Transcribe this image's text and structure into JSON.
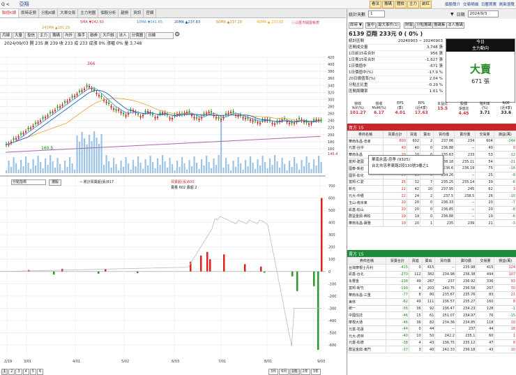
{
  "window": {
    "title": "亞翔",
    "nav_back": "Q <",
    "right_buttons": [
      "看法",
      "籌碼",
      "體檢",
      "主力",
      "啟紅"
    ],
    "links": [
      "個股簡介",
      "交易明細",
      "日曆買賣",
      "刷新瀏覽"
    ]
  },
  "tabs": [
    "聯經K線",
    "即時走勢",
    "分點K線",
    "大單交易",
    "主力地圖",
    "個股分析",
    "趨勢",
    "資訊",
    "官網"
  ],
  "ma": [
    {
      "t": "5MA ▼242.50",
      "c": "#c33"
    },
    {
      "t": "10MA ▼241.65",
      "c": "#3a8ad8"
    },
    {
      "t": "20MA ▲237.83",
      "c": "#0d4fae"
    },
    {
      "t": "60MA ▲237.28",
      "c": "#c48a1a"
    },
    {
      "t": "40MA ▲ 233.65",
      "c": "#f0a020"
    },
    {
      "t": "240MA ▲181.29",
      "c": "#c93"
    },
    {
      "t": "ⓘ以匯市開盤帳表",
      "c": "#c37"
    }
  ],
  "subtabs": [
    "月線",
    "大量",
    "投信",
    "主力",
    "籌碼",
    "內外",
    "換手",
    "融券",
    "大戶融",
    "法人",
    "分價圖",
    "日線"
  ],
  "info_line": "2024/09/03 開 235 高 239 收 233 成 233  成漲 0% 漲幅 0% 量 3,748",
  "chart_data": {
    "type": "line",
    "dates": [
      "2/19",
      "3/01",
      "4/01",
      "5/02",
      "6/03",
      "7/01",
      "8/01",
      "9/03"
    ],
    "price_ticks": [
      420,
      400,
      380,
      360,
      340,
      320,
      300,
      280,
      260,
      240,
      220,
      200,
      180,
      160,
      146.4
    ],
    "price_high": 366,
    "price_low": 160.5,
    "last": 146.4,
    "indicator_ticks": [
      700,
      600,
      500,
      400,
      300,
      200,
      100,
      0,
      -100,
      -200,
      -300,
      -400,
      -500,
      -600
    ]
  },
  "lower": {
    "dropdown": "分點指標",
    "btn": "選股",
    "legend1": "─ 累計買賣超(張)817",
    "legend2": "買賣超(張)600",
    "legend3": "賣量 602 賣超 2"
  },
  "bottom_tabs": [
    "1",
    "2",
    "3",
    "4",
    "5",
    "6"
  ],
  "range_tabs": [
    "3月",
    "6月",
    "1年",
    "2年",
    "3年"
  ],
  "date_footer": "2024/09/03",
  "right": {
    "label_range": "統計天數",
    "days": "1",
    "sel": "▼",
    "date_label": "日期",
    "date": "2024/9/3",
    "tag1": "即時 ▼",
    "tags": [
      "盤中",
      "最大事件(1)",
      "財報",
      "分點籌碼",
      "籌碼集",
      "法人籌碼"
    ],
    "stock_title": "6139 亞翔  233元  0 ( 0% )",
    "kv": [
      [
        "統計區間",
        "20240903 ~ 20240903"
      ],
      [
        "區間成交量",
        "3,748 張"
      ],
      [
        "1日前15名合計",
        "956 張"
      ],
      [
        "1日賣15名合計",
        "-1,627 張"
      ],
      [
        "1日價值中",
        "-671 張"
      ],
      [
        "1日價值中(%)",
        "-17.9 %"
      ],
      [
        "20日價值率(%)",
        "2.04 %"
      ],
      [
        "分點主比重",
        "-0.29 %"
      ],
      [
        "區間周轉率",
        "1.61 %"
      ]
    ],
    "today": {
      "h1": "今日",
      "h2": "主力動向",
      "big": "大賣",
      "sub": "671 張"
    },
    "fin": [
      [
        "營收",
        "YoY(%)",
        "101.27"
      ],
      [
        "營收",
        "MoM(%)",
        "6.17"
      ],
      [
        "EPS",
        "(季)",
        "4.01"
      ],
      [
        "EPS",
        "(近4季)",
        "17.63"
      ],
      [
        "本益比",
        "",
        "15.5"
      ],
      [
        "股價",
        "淨值比",
        "4.45"
      ],
      [
        "殖利率",
        "(%)",
        "3.71"
      ],
      [
        "ROE",
        "(近4季)",
        "33.6"
      ]
    ],
    "buy_title": "買方 15",
    "sell_title": "賣方 15",
    "head": [
      "券商名稱",
      "買賣合計",
      "買進",
      "賣出",
      "買均價",
      "賣均價",
      "交易量",
      "損益(萬)"
    ],
    "buy": [
      [
        "華南永昌-忠孝",
        "高木高",
        "600",
        "602",
        "2",
        "237.06",
        "234",
        "604",
        "-244"
      ],
      [
        "元富-台中",
        "",
        "40",
        "40",
        "0",
        "236.88",
        "--",
        "40",
        "0"
      ],
      [
        "華南永昌",
        "",
        "20",
        "20",
        "0",
        "235.63",
        "233",
        "53",
        "-12"
      ],
      [
        "富邦-建國",
        "",
        "19",
        "19",
        "0",
        "238.18",
        "235.11",
        "54",
        "-21"
      ],
      [
        "國泰-新莊",
        "",
        "35",
        "35",
        "0",
        "236.6",
        "236.19",
        "75",
        "-16"
      ],
      [
        "國票-彰化",
        "",
        "25",
        "25",
        "0",
        "234.26",
        "--",
        "25",
        "-9"
      ],
      [
        "富邦-仁愛",
        "高",
        "25",
        "32",
        "7",
        "235.25",
        "235.14",
        "39",
        "-6"
      ],
      [
        "新光",
        "高",
        "22",
        "42",
        "20",
        "237.95",
        "245",
        "62",
        "3"
      ],
      [
        "元大-中壢",
        "高",
        "22",
        "24",
        "2",
        "237.5",
        "238.5",
        "26",
        "-10"
      ],
      [
        "玉山-南京東",
        "",
        "20",
        "20",
        "0",
        "236.33",
        "--",
        "20",
        "-7"
      ],
      [
        "凱基-松山",
        "",
        "20",
        "20",
        "0",
        "236.85",
        "--",
        "20",
        "-8"
      ],
      [
        "群益金鼎-西松",
        "",
        "19",
        "19",
        "0",
        "236.88",
        "--",
        "19",
        "-6"
      ],
      [
        "華南永昌-寶雅",
        "",
        "19",
        "20",
        "1",
        "235",
        "239",
        "21",
        "-3"
      ]
    ],
    "sell": [
      [
        "台灣摩根士丹利",
        "出售集",
        "-415",
        "0",
        "415",
        "--",
        "235.98",
        "415",
        "124"
      ],
      [
        "凱基-台北",
        "出售集",
        "-270",
        "112",
        "382",
        "234.98",
        "236.38",
        "494",
        "107"
      ],
      [
        "永豐金",
        "出售集",
        "-238",
        "49",
        "287",
        "237",
        "236.92",
        "336",
        "93"
      ],
      [
        "富邦-新竹",
        "",
        "-199",
        "4",
        "203",
        "240.75",
        "236.58",
        "207",
        "70"
      ],
      [
        "華南永昌-三重",
        "",
        "-77",
        "8",
        "80",
        "235.67",
        "235.76",
        "83",
        "21"
      ],
      [
        "美林",
        "出售集",
        "-62",
        "49",
        "111",
        "236.57",
        "235.27",
        "160",
        "8"
      ],
      [
        "統一",
        "出售集",
        "-56",
        "36",
        "92",
        "236.47",
        "234.23",
        "128",
        "-1"
      ],
      [
        "中國信託",
        "",
        "-46",
        "15",
        "61",
        "251.07",
        "234.97",
        "76",
        "-15"
      ],
      [
        "摩根大通",
        "出售集",
        "-46",
        "36",
        "82",
        "234.36",
        "234.85",
        "118",
        "10"
      ],
      [
        "元富-花蓮",
        "",
        "-44",
        "0",
        "44",
        "--",
        "237",
        "44",
        "18"
      ],
      [
        "元大-虎林",
        "",
        "-40",
        "10",
        "50",
        "242.2",
        "235.1",
        "60",
        "1"
      ],
      [
        "元富-松德",
        "",
        "-38",
        "4",
        "43",
        "236.75",
        "235.12",
        "47",
        "8"
      ],
      [
        "群益金鼎-東門",
        "",
        "-37",
        "3",
        "40",
        "242.33",
        "236.18",
        "43",
        "10"
      ]
    ]
  },
  "tooltip": {
    "l1": "華南永昌-忠孝 (9325)",
    "l2": "台北市忠孝東路2段130號3樓之1"
  }
}
